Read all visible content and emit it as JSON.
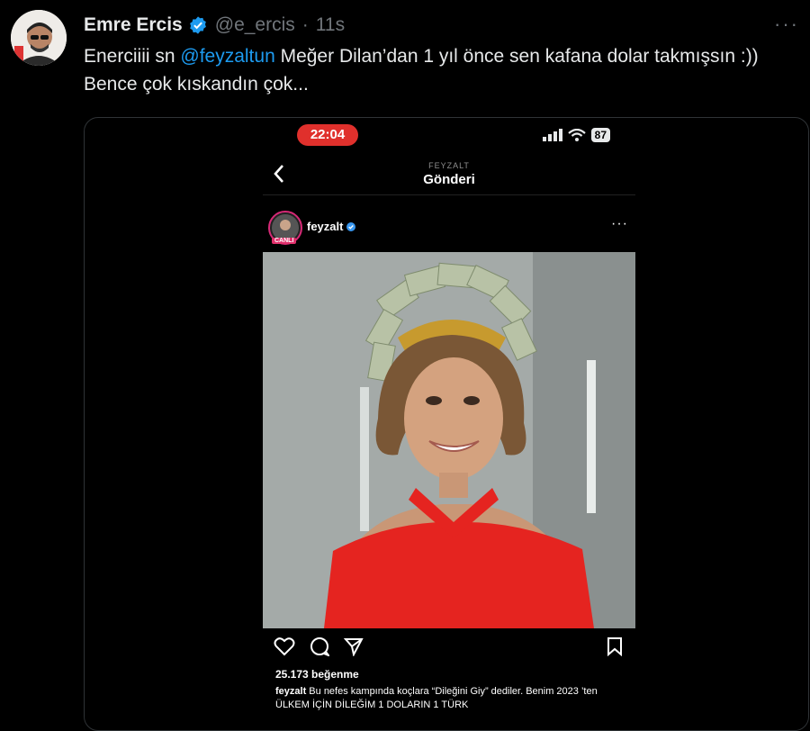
{
  "tweet": {
    "author_name": "Emre Ercis",
    "handle": "@e_ercis",
    "separator": "·",
    "time": "11s",
    "text_before": "Enerciiii sn ",
    "mention": "@feyzaltun",
    "text_after": " Meğer Dilan’dan 1 yıl önce sen kafana dolar takmışsın :)) Bence çok kıskandın çok...",
    "more_label": "···"
  },
  "phone": {
    "status_time": "22:04",
    "battery": "87",
    "header_small": "FEYZALT",
    "header_title": "Gönderi",
    "live_badge": "CANLI",
    "post_user": "feyzalt",
    "likes": "25.173 beğenme",
    "caption_user": "feyzalt",
    "caption_text": " Bu nefes kampında koçlara “Dileğini Giy” dediler. Benim 2023 ’ten ÜLKEM İÇİN DİLEĞİM 1 DOLARIN 1 TÜRK"
  },
  "colors": {
    "accent": "#1d9bf0",
    "live": "#e1306c",
    "clock": "#e0302c",
    "dress": "#e52420"
  },
  "icons": [
    "verified-badge-icon",
    "more-icon",
    "back-chevron-icon",
    "heart-icon",
    "comment-icon",
    "share-icon",
    "bookmark-icon",
    "signal-icon",
    "wifi-icon"
  ]
}
